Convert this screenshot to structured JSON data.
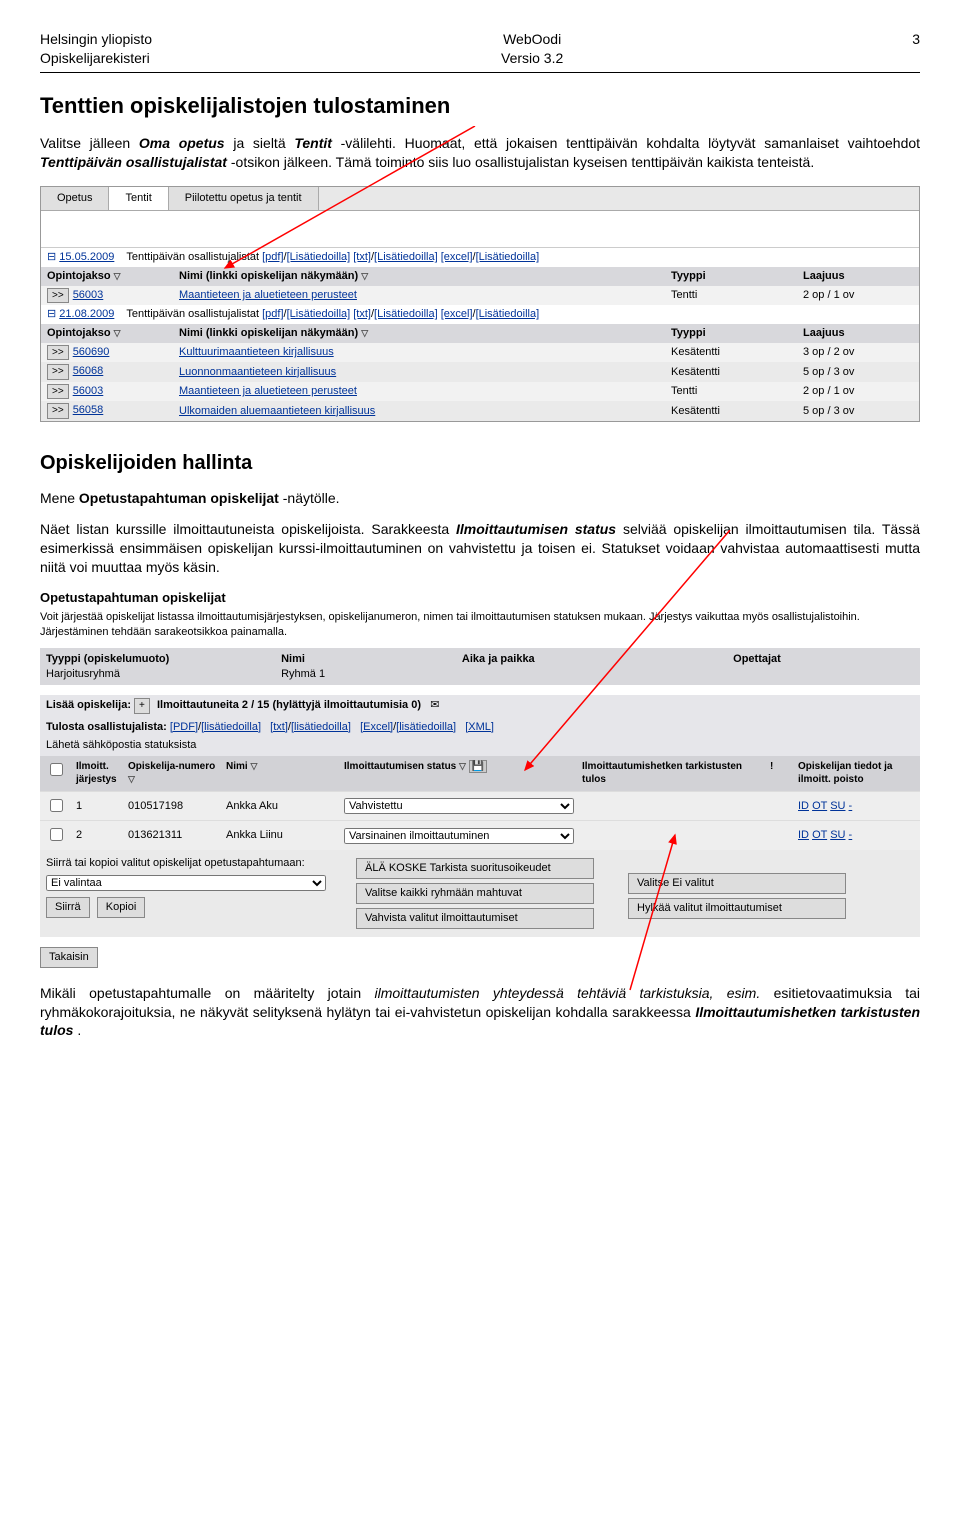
{
  "header": {
    "left1": "Helsingin yliopisto",
    "left2": "Opiskelijarekisteri",
    "center1": "WebOodi",
    "center2": "Versio 3.2",
    "right": "3"
  },
  "title": "Tenttien opiskelijalistojen tulostaminen",
  "para1a": "Valitse jälleen ",
  "para1b": "Oma opetus",
  "para1c": " ja sieltä ",
  "para1d": "Tentit",
  "para1e": "-välilehti. Huomaat, että jokaisen tenttipäivän kohdalta löytyvät samanlaiset vaihtoehdot ",
  "para1f": "Tenttipäivän osallistujalistat",
  "para1g": " -otsikon jälkeen. Tämä toiminto siis luo osallistujalistan kyseisen tenttipäivän kaikista tenteistä.",
  "shot1": {
    "tabs": [
      "Opetus",
      "Tentit",
      "Piilotettu opetus ja tentit"
    ],
    "dates": [
      {
        "date": "15.05.2009",
        "label": "Tenttipäivän osallistujalistat",
        "links": [
          "[pdf]",
          "/",
          "[Lisätiedoilla]",
          "[txt]",
          "/",
          "[Lisätiedoilla]",
          "[excel]",
          "/",
          "[Lisätiedoilla]"
        ],
        "hdr": [
          "Opintojakso",
          "Nimi (linkki opiskelijan näkymään)",
          "Tyyppi",
          "Laajuus"
        ],
        "rows": [
          {
            "code": "56003",
            "name": "Maantieteen ja aluetieteen perusteet",
            "type": "Tentti",
            "scope": "2 op / 1 ov"
          }
        ]
      },
      {
        "date": "21.08.2009",
        "label": "Tenttipäivän osallistujalistat",
        "links": [
          "[pdf]",
          "/",
          "[Lisätiedoilla]",
          "[txt]",
          "/",
          "[Lisätiedoilla]",
          "[excel]",
          "/",
          "[Lisätiedoilla]"
        ],
        "hdr": [
          "Opintojakso",
          "Nimi (linkki opiskelijan näkymään)",
          "Tyyppi",
          "Laajuus"
        ],
        "rows": [
          {
            "code": "560690",
            "name": "Kulttuurimaantieteen kirjallisuus",
            "type": "Kesätentti",
            "scope": "3 op / 2 ov"
          },
          {
            "code": "56068",
            "name": "Luonnonmaantieteen kirjallisuus",
            "type": "Kesätentti",
            "scope": "5 op / 3 ov"
          },
          {
            "code": "56003",
            "name": "Maantieteen ja aluetieteen perusteet",
            "type": "Tentti",
            "scope": "2 op / 1 ov"
          },
          {
            "code": "56058",
            "name": "Ulkomaiden aluemaantieteen kirjallisuus",
            "type": "Kesätentti",
            "scope": "5 op / 3 ov"
          }
        ]
      }
    ]
  },
  "h2": "Opiskelijoiden hallinta",
  "para2a": "Mene ",
  "para2b": "Opetustapahtuman opiskelijat",
  "para2c": " -näytölle.",
  "para3a": "Näet listan kurssille ilmoittautuneista opiskelijoista. Sarakkeesta ",
  "para3b": "Ilmoittautumisen status",
  "para3c": " selviää opiskelijan ilmoittautumisen tila. Tässä esimerkissä ensimmäisen opiskelijan kurssi-ilmoittautuminen on vahvistettu ja toisen ei. Statukset voidaan vahvistaa automaattisesti mutta niitä voi muuttaa myös käsin.",
  "shot2": {
    "title": "Opetustapahtuman opiskelijat",
    "intro": "Voit järjestää opiskelijat listassa ilmoittautumisjärjestyksen, opiskelijanumeron, nimen tai ilmoittautumisen statuksen mukaan. Järjestys vaikuttaa myös osallistujalistoihin. Järjestäminen tehdään sarakeotsikkoa painamalla.",
    "info": {
      "type_lbl": "Tyyppi (opiskelumuoto)",
      "type_val": "Harjoitusryhmä",
      "name_lbl": "Nimi",
      "name_val": "Ryhmä 1",
      "time_lbl": "Aika ja paikka",
      "teach_lbl": "Opettajat"
    },
    "tool1a": "Lisää opiskelija:",
    "tool1b": "Ilmoittautuneita 2 / 15 (hylättyjä ilmoittautumisia 0)",
    "tool2a": "Tulosta osallistujalista:",
    "tool2links": [
      "[PDF]",
      "/",
      "[lisätiedoilla]",
      "[txt]",
      "/",
      "[lisätiedoilla]",
      "[Excel]",
      "/",
      "[lisätiedoilla]",
      "[XML]"
    ],
    "hdr": {
      "chk": "",
      "ord": "Ilmoitt. järjestys",
      "num": "Opiskelija-numero",
      "name": "Nimi",
      "status": "Ilmoittautumisen status",
      "tark": "Ilmoittautumishetken tarkistusten tulos",
      "warn": "!",
      "ops": "Opiskelijan tiedot ja ilmoitt. poisto"
    },
    "rows": [
      {
        "ord": "1",
        "num": "010517198",
        "name": "Ankka Aku",
        "status": "Vahvistettu",
        "ops": [
          "ID",
          "OT",
          "SU",
          "-"
        ]
      },
      {
        "ord": "2",
        "num": "013621311",
        "name": "Ankka Liinu",
        "status": "Varsinainen ilmoittautuminen",
        "ops": [
          "ID",
          "OT",
          "SU",
          "-"
        ]
      }
    ],
    "footer": {
      "move_lbl": "Siirrä tai kopioi valitut opiskelijat opetustapahtumaan:",
      "move_sel": "Ei valintaa",
      "siirra": "Siirrä",
      "kopioi": "Kopioi",
      "btn1": "ÄLÄ KOSKE Tarkista suoritusoikeudet",
      "btn2": "Valitse kaikki ryhmään mahtuvat",
      "btn3": "Vahvista valitut ilmoittautumiset",
      "btn4": "Valitse Ei valitut",
      "btn5": "Hylkää valitut ilmoittautumiset",
      "sahko": "Lähetä sähköpostia statuksista"
    },
    "back": "Takaisin"
  },
  "para4a": "Mikäli opetustapahtumalle on määritelty jotain ",
  "para4b": "ilmoittautumisten yhteydessä tehtäviä tarkistuksia, esim.",
  "para4c": " esitietovaatimuksia tai ryhmäkokorajoituksia, ne näkyvät selityksenä hylätyn tai ei-vahvistetun opiskelijan kohdalla sarakkeessa ",
  "para4d": "Ilmoittautumishetken tarkistusten tulos",
  "para4e": "."
}
